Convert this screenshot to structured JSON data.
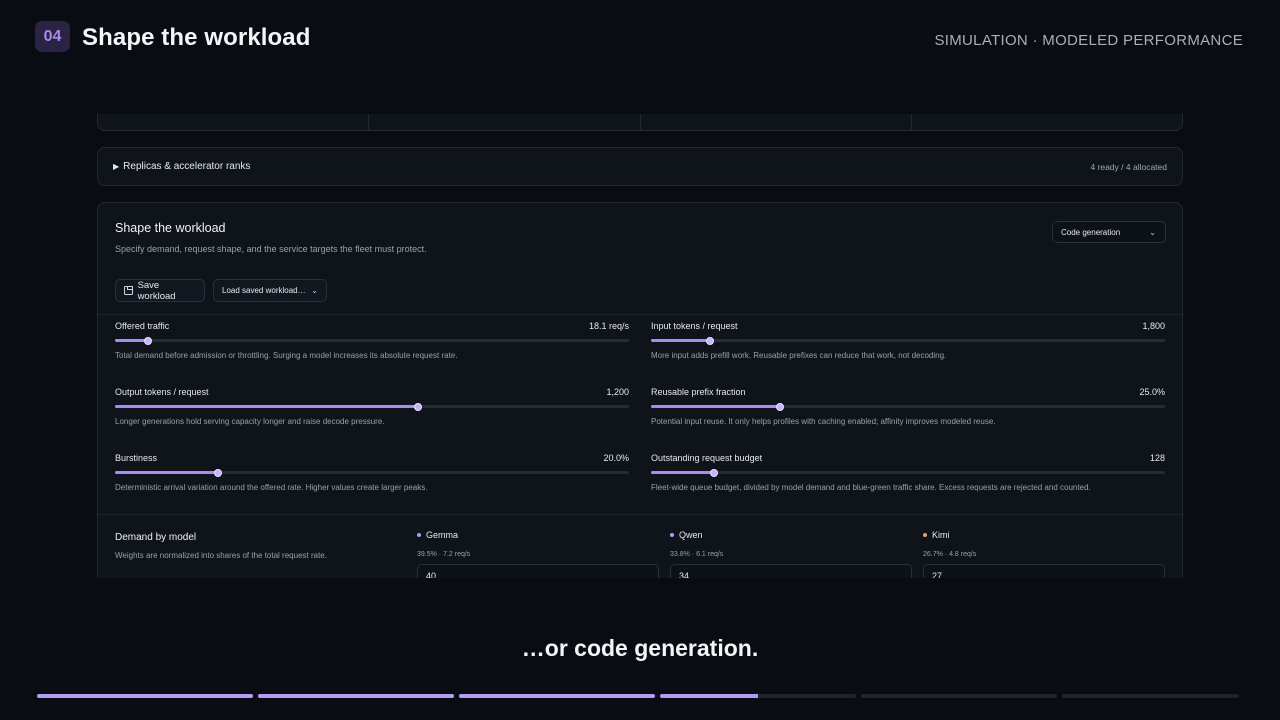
{
  "header": {
    "step": "04",
    "title": "Shape the workload",
    "mode": "SIMULATION · MODELED PERFORMANCE"
  },
  "replicas": {
    "summary": "Replicas & accelerator ranks",
    "status": "4 ready / 4 allocated"
  },
  "workload": {
    "title": "Shape the workload",
    "subtitle": "Specify demand, request shape, and the service targets the fleet must protect.",
    "preset": "Code generation",
    "save_label": "Save workload",
    "load_label": "Load saved workload…",
    "sliders": [
      {
        "label": "Offered traffic",
        "value": "18.1 req/s",
        "fraction": 0.065,
        "desc": "Total demand before admission or throttling. Surging a model increases its absolute request rate."
      },
      {
        "label": "Input tokens / request",
        "value": "1,800",
        "fraction": 0.115,
        "desc": "More input adds prefill work. Reusable prefixes can reduce that work, not decoding."
      },
      {
        "label": "Output tokens / request",
        "value": "1,200",
        "fraction": 0.59,
        "desc": "Longer generations hold serving capacity longer and raise decode pressure."
      },
      {
        "label": "Reusable prefix fraction",
        "value": "25.0%",
        "fraction": 0.25,
        "desc": "Potential input reuse. It only helps profiles with caching enabled; affinity improves modeled reuse."
      },
      {
        "label": "Burstiness",
        "value": "20.0%",
        "fraction": 0.2,
        "desc": "Deterministic arrival variation around the offered rate. Higher values create larger peaks."
      },
      {
        "label": "Outstanding request budget",
        "value": "128",
        "fraction": 0.122,
        "desc": "Fleet-wide queue budget, divided by model demand and blue-green traffic share. Excess requests are rejected and counted."
      }
    ],
    "demand": {
      "title": "Demand by model",
      "subtitle": "Weights are normalized into shares of the total request rate.",
      "models": [
        {
          "name": "Gemma",
          "share": "39.5% · 7.2 req/s",
          "weight": "40",
          "color": "#8fa8f5"
        },
        {
          "name": "Qwen",
          "share": "33.8% · 6.1 req/s",
          "weight": "34",
          "color": "#b39cf5"
        },
        {
          "name": "Kimi",
          "share": "26.7% · 4.8 req/s",
          "weight": "27",
          "color": "#e3a25b"
        }
      ]
    }
  },
  "caption": "…or code generation.",
  "progress": [
    1,
    1,
    1,
    0.5,
    0,
    0
  ]
}
